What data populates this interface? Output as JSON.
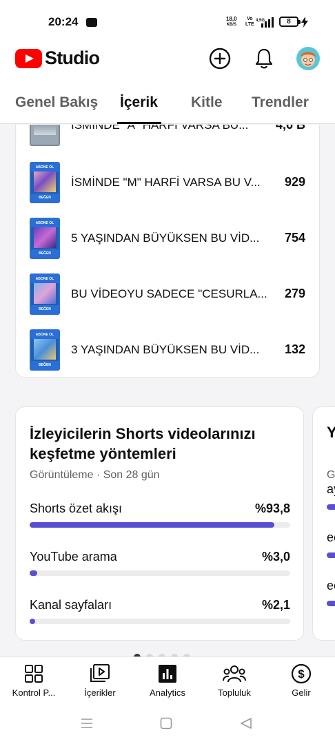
{
  "status_bar": {
    "time": "20:24",
    "speed_value": "18,0",
    "speed_unit": "KB/S",
    "volte_top": "Vo",
    "volte_bottom": "LTE",
    "network": "4,5G",
    "battery": "8"
  },
  "header": {
    "logo_text": "Studio",
    "icons": [
      "create-icon",
      "notifications-icon",
      "avatar"
    ]
  },
  "tabs": [
    {
      "label": "Genel Bakış",
      "active": false
    },
    {
      "label": "İçerik",
      "active": true
    },
    {
      "label": "Kitle",
      "active": false
    },
    {
      "label": "Trendler",
      "active": false
    }
  ],
  "top_videos": [
    {
      "title": "İSMİNDE \"A\" HARFİ VARSA BU...",
      "views": "4,6 B"
    },
    {
      "title": "İSMİNDE \"M\" HARFİ VARSA BU V...",
      "views": "929",
      "thumb_top": "ABONE OL",
      "thumb_bottom": "BEĞEN"
    },
    {
      "title": "5 YAŞINDAN BÜYÜKSEN BU VİD...",
      "views": "754",
      "thumb_top": "ABONE OL",
      "thumb_bottom": "BEĞEN"
    },
    {
      "title": "BU VİDEOYU SADECE \"CESURLA...",
      "views": "279",
      "thumb_top": "ABONE OL",
      "thumb_bottom": "BEĞEN"
    },
    {
      "title": "3 YAŞINDAN BÜYÜKSEN BU VİD...",
      "views": "132",
      "thumb_top": "ABONE OL",
      "thumb_bottom": "BEĞEN"
    }
  ],
  "discovery": {
    "title": "İzleyicilerin Shorts videolarınızı keşfetme yöntemleri",
    "subtitle": "Görüntüleme · Son 28 gün",
    "sources": [
      {
        "label": "Shorts özet akışı",
        "value": "%93,8",
        "fraction": 0.938
      },
      {
        "label": "YouTube arama",
        "value": "%3,0",
        "fraction": 0.03
      },
      {
        "label": "Kanal sayfaları",
        "value": "%2,1",
        "fraction": 0.021
      }
    ],
    "bar_color": "#5b4fd1"
  },
  "peek_card": {
    "title": "Y",
    "subtitle": "G",
    "rows": [
      "ay",
      "ee",
      "ee"
    ]
  },
  "pager": {
    "count": 5,
    "active": 0
  },
  "bottom_nav": [
    {
      "label": "Kontrol P...",
      "icon": "dashboard-icon"
    },
    {
      "label": "İçerikler",
      "icon": "content-icon"
    },
    {
      "label": "Analytics",
      "icon": "analytics-icon",
      "active": true
    },
    {
      "label": "Topluluk",
      "icon": "community-icon"
    },
    {
      "label": "Gelir",
      "icon": "earn-icon"
    }
  ]
}
